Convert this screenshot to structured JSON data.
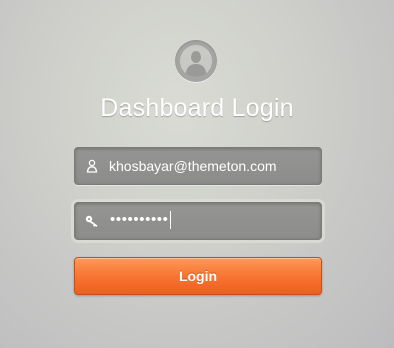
{
  "header": {
    "title": "Dashboard Login",
    "avatar_icon": "user-avatar-icon"
  },
  "form": {
    "email": {
      "value": "khosbayar@themeton.com",
      "icon": "user-icon"
    },
    "password": {
      "masked_value": "••••••••••",
      "icon": "key-icon"
    },
    "submit_label": "Login"
  },
  "colors": {
    "accent": "#f87532",
    "field_bg": "#8f8f8d",
    "text": "#ffffff"
  }
}
